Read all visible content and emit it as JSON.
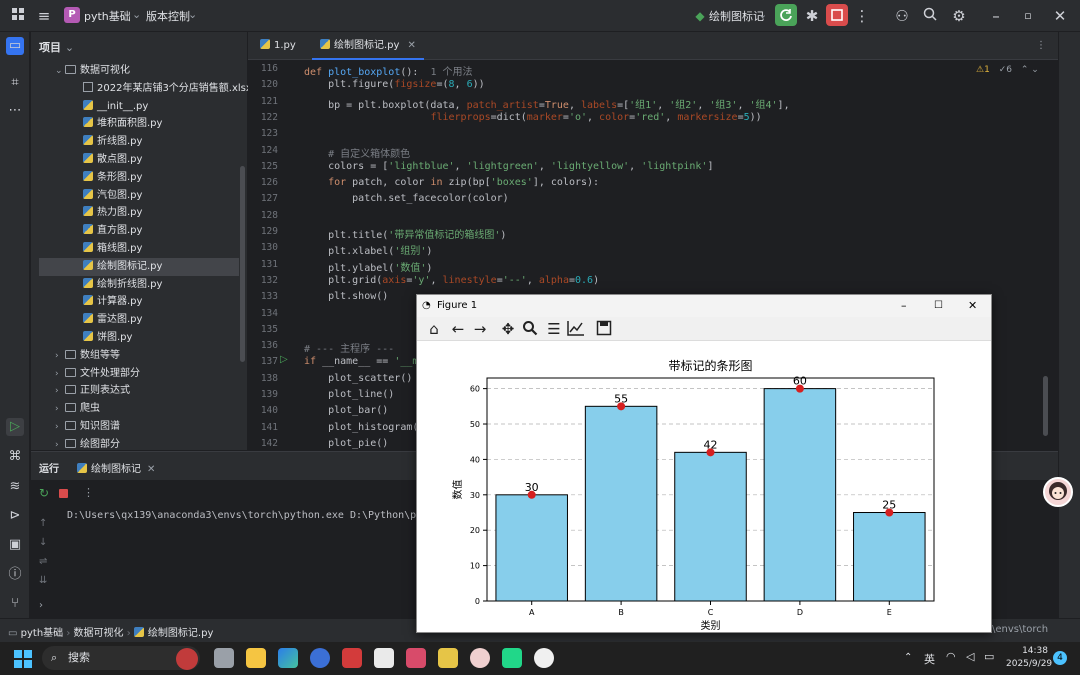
{
  "titlebar": {
    "project": "pyth基础",
    "badge": "P",
    "vcs": "版本控制",
    "run_config": "绘制图标记"
  },
  "project_panel": {
    "title": "项目",
    "items": [
      {
        "label": "数据可视化",
        "kind": "folder",
        "depth": 1,
        "open": true
      },
      {
        "label": "2022年某店铺3个分店销售额.xlsx",
        "kind": "xls",
        "depth": 2
      },
      {
        "label": "__init__.py",
        "kind": "py",
        "depth": 2
      },
      {
        "label": "堆积面积图.py",
        "kind": "py",
        "depth": 2
      },
      {
        "label": "折线图.py",
        "kind": "py",
        "depth": 2
      },
      {
        "label": "散点图.py",
        "kind": "py",
        "depth": 2
      },
      {
        "label": "条形图.py",
        "kind": "py",
        "depth": 2
      },
      {
        "label": "汽包图.py",
        "kind": "py",
        "depth": 2
      },
      {
        "label": "热力图.py",
        "kind": "py",
        "depth": 2
      },
      {
        "label": "直方图.py",
        "kind": "py",
        "depth": 2
      },
      {
        "label": "箱线图.py",
        "kind": "py",
        "depth": 2
      },
      {
        "label": "绘制图标记.py",
        "kind": "py",
        "depth": 2,
        "selected": true
      },
      {
        "label": "绘制折线图.py",
        "kind": "py",
        "depth": 2
      },
      {
        "label": "计算器.py",
        "kind": "py",
        "depth": 2
      },
      {
        "label": "雷达图.py",
        "kind": "py",
        "depth": 2
      },
      {
        "label": "饼图.py",
        "kind": "py",
        "depth": 2
      },
      {
        "label": "数组等等",
        "kind": "folder",
        "depth": 1
      },
      {
        "label": "文件处理部分",
        "kind": "folder",
        "depth": 1
      },
      {
        "label": "正则表达式",
        "kind": "folder",
        "depth": 1
      },
      {
        "label": "爬虫",
        "kind": "folder",
        "depth": 1
      },
      {
        "label": "知识图谱",
        "kind": "folder",
        "depth": 1
      },
      {
        "label": "绘图部分",
        "kind": "folder",
        "depth": 1
      }
    ]
  },
  "editor": {
    "tabs": [
      {
        "label": "1.py"
      },
      {
        "label": "绘制图标记.py",
        "active": true
      }
    ],
    "inspection": {
      "warnings": "1",
      "weak": "6"
    },
    "lines": [
      {
        "n": "116",
        "html": "<span class='kw'>def</span> <span class='fn'>plot_boxplot</span>():  <span class='cm'>1 个用法</span>"
      },
      {
        "n": "120",
        "html": "    plt.figure(<span class='kwa'>figsize</span>=(<span class='num'>8</span>, <span class='num'>6</span>))"
      },
      {
        "n": "121",
        "html": "    bp = plt.boxplot(data, <span class='kwa'>patch_artist</span>=<span class='kw'>True</span>, <span class='kwa'>labels</span>=[<span class='str'>'组1'</span>, <span class='str'>'组2'</span>, <span class='str'>'组3'</span>, <span class='str'>'组4'</span>],"
      },
      {
        "n": "122",
        "html": "                     <span class='kwa'>flierprops</span>=dict(<span class='kwa'>marker</span>=<span class='str'>'o'</span>, <span class='kwa'>color</span>=<span class='str'>'red'</span>, <span class='kwa'>markersize</span>=<span class='num'>5</span>))"
      },
      {
        "n": "123",
        "html": ""
      },
      {
        "n": "124",
        "html": "    <span class='cm'># 自定义箱体颜色</span>"
      },
      {
        "n": "125",
        "html": "    colors = [<span class='str'>'lightblue'</span>, <span class='str'>'lightgreen'</span>, <span class='str'>'lightyellow'</span>, <span class='str'>'lightpink'</span>]"
      },
      {
        "n": "126",
        "html": "    <span class='kw'>for</span> patch, color <span class='kw'>in</span> zip(bp[<span class='str'>'boxes'</span>], colors):"
      },
      {
        "n": "127",
        "html": "        patch.set_facecolor(color)"
      },
      {
        "n": "128",
        "html": ""
      },
      {
        "n": "129",
        "html": "    plt.title(<span class='str'>'带异常值标记的箱线图'</span>)"
      },
      {
        "n": "130",
        "html": "    plt.xlabel(<span class='str'>'组别'</span>)"
      },
      {
        "n": "131",
        "html": "    plt.ylabel(<span class='str'>'数值'</span>)"
      },
      {
        "n": "132",
        "html": "    plt.grid(<span class='kwa'>axis</span>=<span class='str'>'y'</span>, <span class='kwa'>linestyle</span>=<span class='str'>'--'</span>, <span class='kwa'>alpha</span>=<span class='num'>0.6</span>)"
      },
      {
        "n": "133",
        "html": "    plt.show()"
      },
      {
        "n": "134",
        "html": ""
      },
      {
        "n": "135",
        "html": ""
      },
      {
        "n": "136",
        "html": "<span class='cm'># --- 主程序 ---</span>"
      },
      {
        "n": "137",
        "html": "<span class='kw'>if</span> __name__ == <span class='str'>'__m</span>"
      },
      {
        "n": "138",
        "html": "    plot_scatter()"
      },
      {
        "n": "139",
        "html": "    plot_line()"
      },
      {
        "n": "140",
        "html": "    plot_bar()"
      },
      {
        "n": "141",
        "html": "    plot_histogram("
      },
      {
        "n": "142",
        "html": "    plot_pie()"
      }
    ]
  },
  "run_panel": {
    "label": "运行",
    "tab": "绘制图标记",
    "output": "D:\\Users\\qx139\\anaconda3\\envs\\torch\\python.exe D:\\Python\\py"
  },
  "statusbar": {
    "crumbs": [
      "pyth基础",
      "数据可视化",
      "绘制图标记.py"
    ],
    "interpreter": "\\envs\\torch"
  },
  "taskbar": {
    "search": "搜索",
    "ime": "英",
    "time": "14:38",
    "date": "2025/9/29",
    "notifications": "4"
  },
  "figure": {
    "window_title": "Figure 1"
  },
  "chart_data": {
    "type": "bar",
    "title": "带标记的条形图",
    "xlabel": "类别",
    "ylabel": "数值",
    "categories": [
      "A",
      "B",
      "C",
      "D",
      "E"
    ],
    "values": [
      30,
      55,
      42,
      60,
      25
    ],
    "data_labels": [
      "30",
      "55",
      "42",
      "60",
      "25"
    ],
    "ylim": [
      0,
      63
    ],
    "yticks": [
      0,
      10,
      20,
      30,
      40,
      50,
      60
    ],
    "grid": "y dashed",
    "bar_color": "#87ceeb",
    "marker_color": "#d62020"
  }
}
